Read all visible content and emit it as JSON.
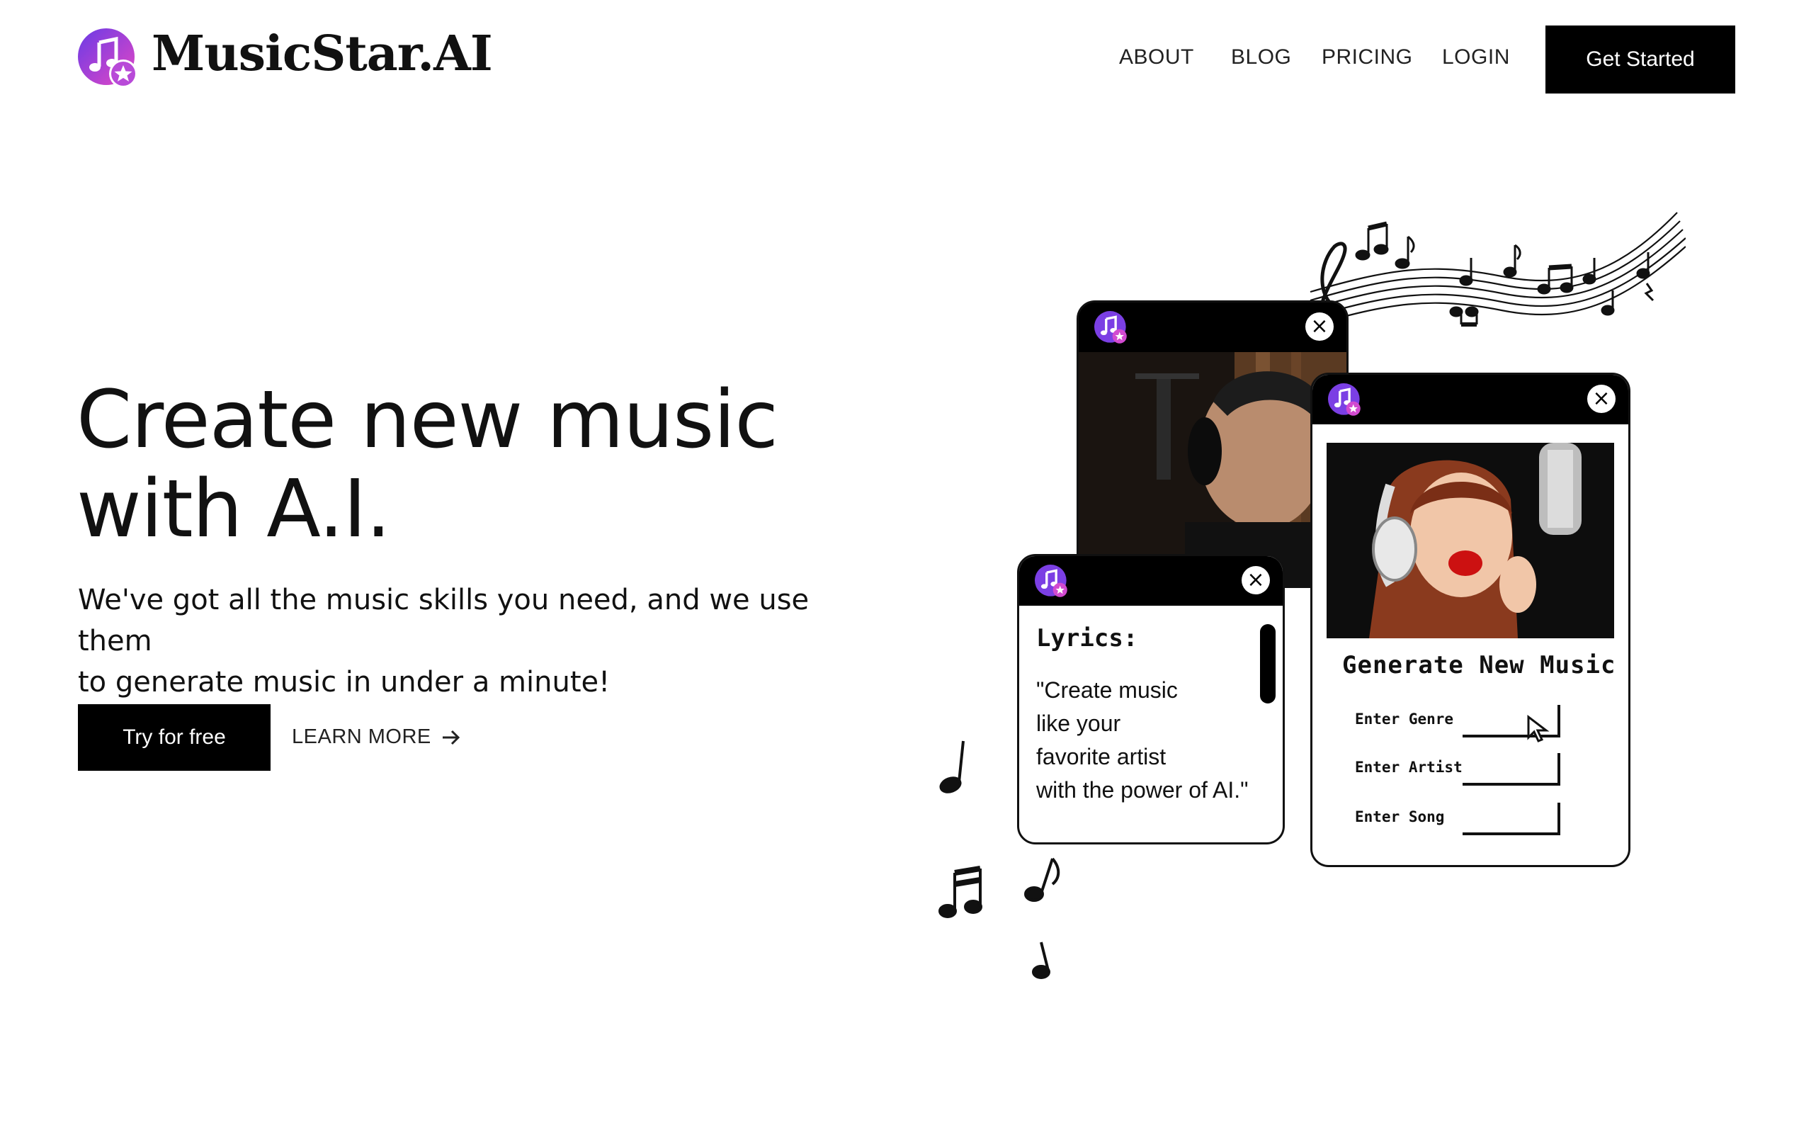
{
  "header": {
    "brand": "MusicStar.AI",
    "logo_icon": "music-star-logo-icon",
    "nav": [
      {
        "label": "ABOUT"
      },
      {
        "label": "BLOG"
      },
      {
        "label": "PRICING"
      },
      {
        "label": "LOGIN"
      }
    ],
    "cta_label": "Get Started"
  },
  "hero": {
    "headline_line1": "Create new music",
    "headline_line2": "with A.I.",
    "subtitle_line1": "We've got all the music skills you need, and we use them",
    "subtitle_line2": "to generate music in under a minute!",
    "primary_button": "Try for free",
    "secondary_link": "LEARN MORE",
    "secondary_icon": "arrow-right-icon"
  },
  "illustration": {
    "lyrics_card": {
      "title": "Lyrics:",
      "text": "\"Create music\n like your\n favorite artist\n with the power of AI.\""
    },
    "generate_card": {
      "title": "Generate New Music",
      "fields": [
        {
          "label": "Enter Genre"
        },
        {
          "label": "Enter Artist"
        },
        {
          "label": "Enter Song"
        }
      ]
    },
    "icons": [
      "close-icon",
      "music-notes-icon",
      "treble-clef-icon",
      "cursor-icon"
    ]
  },
  "colors": {
    "primary": "#000000",
    "background": "#ffffff",
    "logo_gradient_start": "#7b3fe4",
    "logo_gradient_end": "#e84ac9"
  }
}
